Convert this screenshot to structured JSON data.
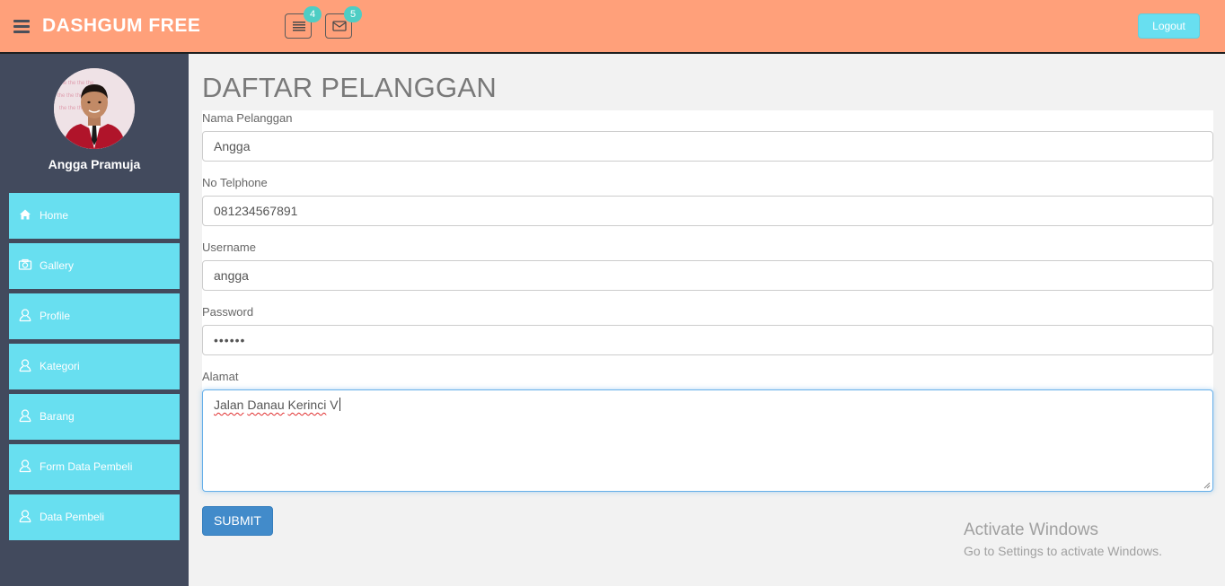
{
  "header": {
    "logo": "DASHGUM FREE",
    "notifications": [
      {
        "icon": "tasks-icon",
        "count": "4"
      },
      {
        "icon": "envelope-icon",
        "count": "5"
      }
    ],
    "logout_label": "Logout",
    "background_color": "#ffa07a"
  },
  "sidebar": {
    "user_name": "Angga Pramuja",
    "items": [
      {
        "label": "Home",
        "icon": "home-icon"
      },
      {
        "label": "Gallery",
        "icon": "camera-icon"
      },
      {
        "label": "Profile",
        "icon": "user-icon"
      },
      {
        "label": "Kategori",
        "icon": "user-icon"
      },
      {
        "label": "Barang",
        "icon": "user-icon"
      },
      {
        "label": "Form Data Pembeli",
        "icon": "user-icon"
      },
      {
        "label": "Data Pembeli",
        "icon": "user-icon"
      }
    ],
    "accent_color": "#68dff0"
  },
  "main": {
    "title": "DAFTAR PELANGGAN",
    "form": {
      "fields": [
        {
          "label": "Nama Pelanggan",
          "value": "Angga"
        },
        {
          "label": "No Telphone",
          "value": "081234567891"
        },
        {
          "label": "Username",
          "value": "angga"
        },
        {
          "label": "Password",
          "value": "••••••"
        }
      ],
      "address": {
        "label": "Alamat",
        "words": [
          "Jalan",
          "Danau",
          "Kerinci",
          "V"
        ]
      },
      "submit_label": "SUBMIT"
    }
  },
  "watermark": {
    "title": "Activate Windows",
    "subtitle": "Go to Settings to activate Windows."
  }
}
